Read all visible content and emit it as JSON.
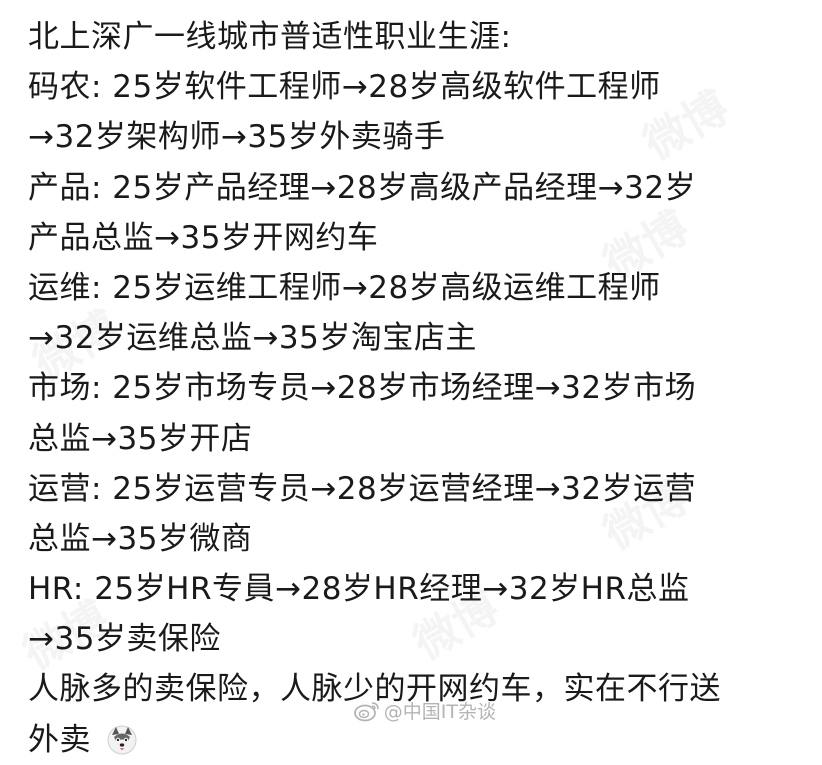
{
  "post": {
    "lines": [
      "北上深广一线城市普适性职业生涯:",
      "码农: 25岁软件工程师→28岁高级软件工程师",
      "→32岁架构师→35岁外卖骑手",
      "产品: 25岁产品经理→28岁高级产品经理→32岁",
      "产品总监→35岁开网约车",
      "运维: 25岁运维工程师→28岁高级运维工程师",
      "→32岁运维总监→35岁淘宝店主",
      "市场: 25岁市场专员→28岁市场经理→32岁市场",
      "总监→35岁开店",
      "运营: 25岁运营专员→28岁运营经理→32岁运营",
      "总监→35岁微商",
      "HR: 25岁HR专員→28岁HR经理→32岁HR总监",
      "→35岁卖保险",
      "人脉多的卖保险，人脉少的开网约车，实在不行送",
      "外卖"
    ],
    "last_emoji": "husky-dog-emoji"
  },
  "watermark": {
    "text": "@中国IT杂谈",
    "icon": "weibo-logo-icon",
    "color": "#b4b4b4"
  }
}
